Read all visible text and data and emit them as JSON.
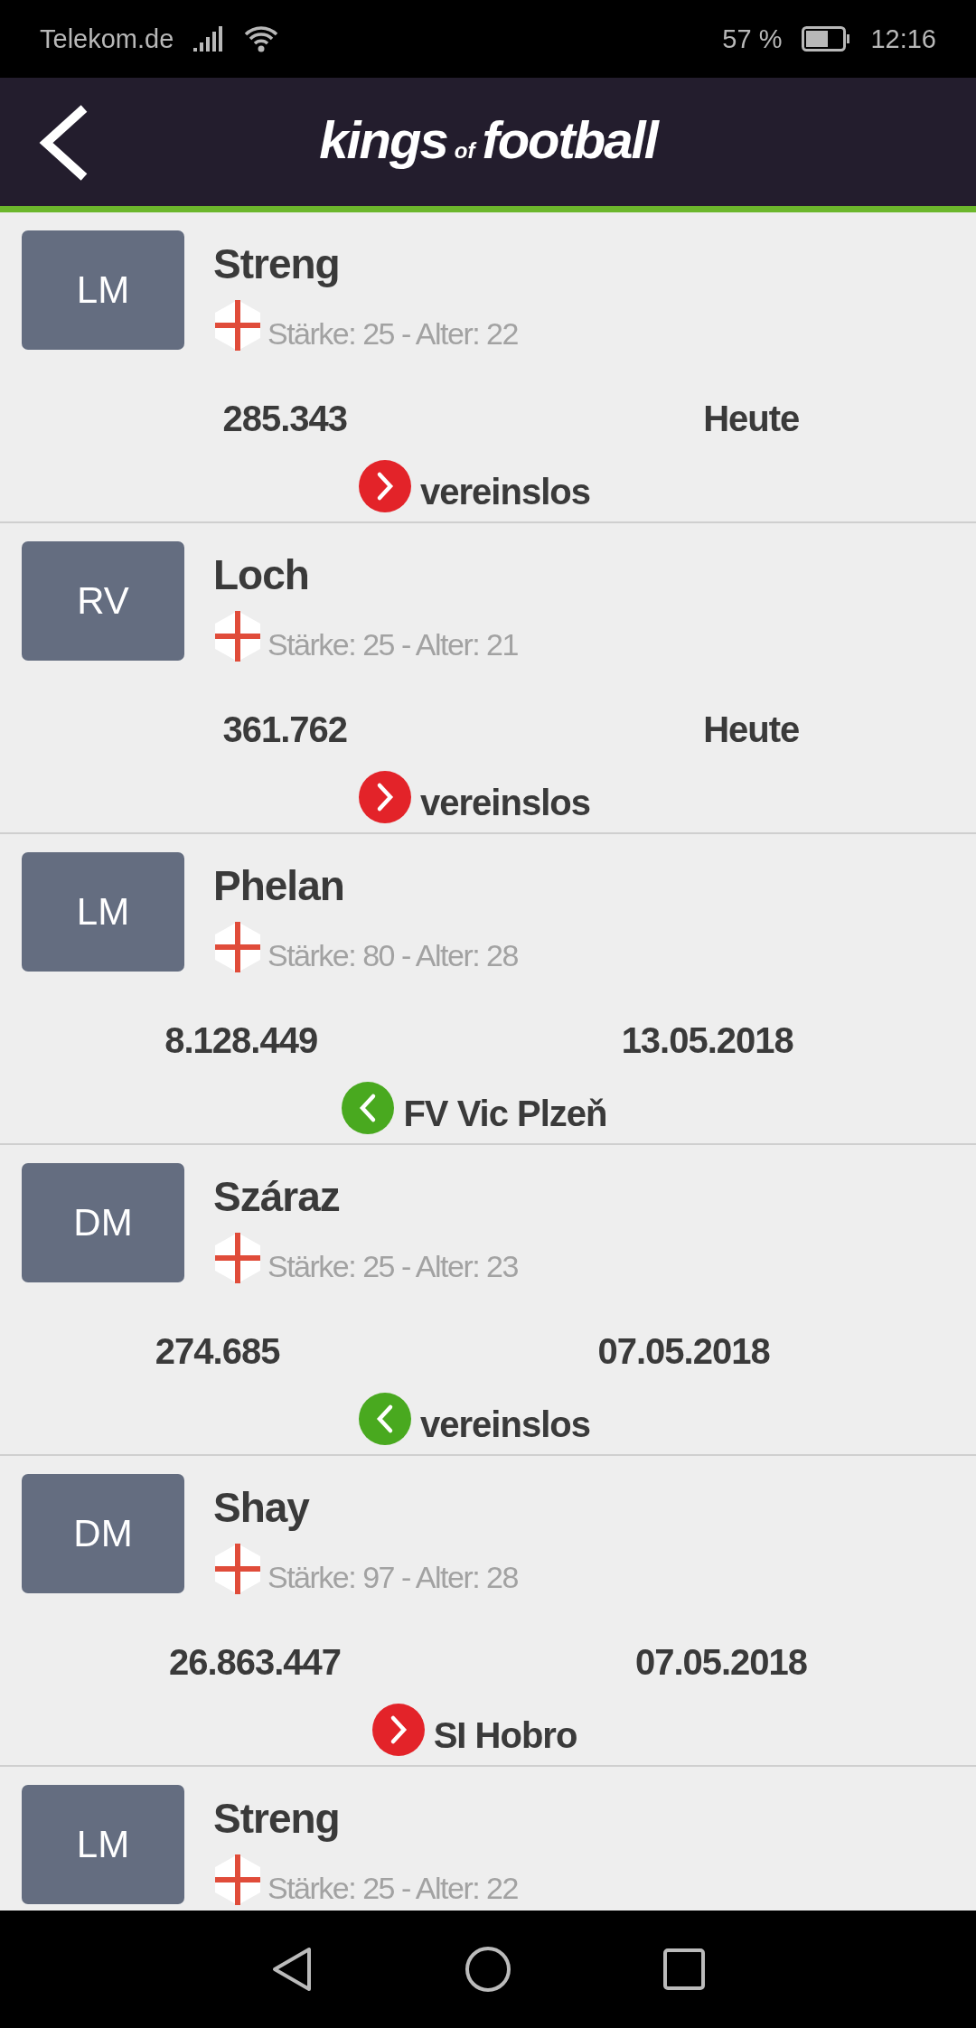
{
  "status_bar": {
    "carrier": "Telekom.de",
    "battery": "57 %",
    "time": "12:16"
  },
  "header": {
    "logo_main": "kings",
    "logo_small": "of",
    "logo_end": "football"
  },
  "players": [
    {
      "position": "LM",
      "name": "Streng",
      "stats": "Stärke: 25 - Alter: 22",
      "value": "285.343",
      "date": "Heute",
      "kind": "out",
      "club": "vereinslos"
    },
    {
      "position": "RV",
      "name": "Loch",
      "stats": "Stärke: 25 - Alter: 21",
      "value": "361.762",
      "date": "Heute",
      "kind": "out",
      "club": "vereinslos"
    },
    {
      "position": "LM",
      "name": "Phelan",
      "stats": "Stärke: 80 - Alter: 28",
      "value": "8.128.449",
      "date": "13.05.2018",
      "kind": "in",
      "club": "FV Vic Plzeň"
    },
    {
      "position": "DM",
      "name": "Száraz",
      "stats": "Stärke: 25 - Alter: 23",
      "value": "274.685",
      "date": "07.05.2018",
      "kind": "in",
      "club": "vereinslos"
    },
    {
      "position": "DM",
      "name": "Shay",
      "stats": "Stärke: 97 - Alter: 28",
      "value": "26.863.447",
      "date": "07.05.2018",
      "kind": "out",
      "club": "SI Hobro"
    },
    {
      "position": "LM",
      "name": "Streng",
      "stats": "Stärke: 25 - Alter: 22"
    }
  ]
}
